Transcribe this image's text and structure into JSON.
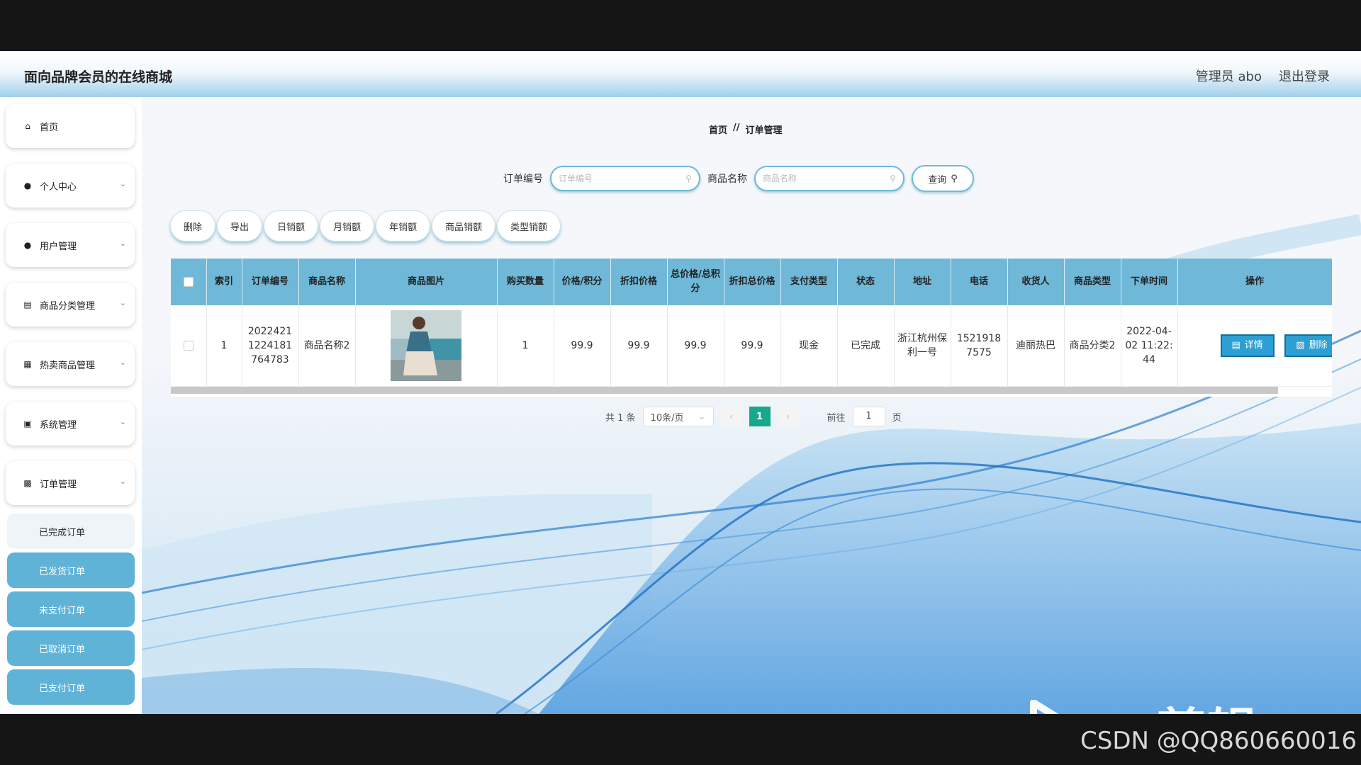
{
  "header": {
    "title": "面向品牌会员的在线商城",
    "user_label": "管理员 abo",
    "logout_label": "退出登录"
  },
  "sidebar": {
    "items": [
      {
        "label": "首页",
        "icon": "home-icon"
      },
      {
        "label": "个人中心",
        "icon": "user-icon"
      },
      {
        "label": "用户管理",
        "icon": "user-icon"
      },
      {
        "label": "商品分类管理",
        "icon": "category-icon"
      },
      {
        "label": "热卖商品管理",
        "icon": "grid-icon"
      },
      {
        "label": "系统管理",
        "icon": "clipboard-icon"
      },
      {
        "label": "订单管理",
        "icon": "order-icon"
      }
    ],
    "order_sub_items": [
      "已完成订单",
      "已发货订单",
      "未支付订单",
      "已取消订单",
      "已支付订单"
    ]
  },
  "breadcrumb": {
    "home": "首页",
    "separator": "//",
    "current": "订单管理"
  },
  "search": {
    "order_no_label": "订单编号",
    "order_no_placeholder": "订单编号",
    "product_name_label": "商品名称",
    "product_name_placeholder": "商品名称",
    "query_label": "查询"
  },
  "actions": [
    "删除",
    "导出",
    "日销额",
    "月销额",
    "年销额",
    "商品销额",
    "类型销额"
  ],
  "table": {
    "headers": [
      "索引",
      "订单编号",
      "商品名称",
      "商品图片",
      "购买数量",
      "价格/积分",
      "折扣价格",
      "总价格/总积分",
      "折扣总价格",
      "支付类型",
      "状态",
      "地址",
      "电话",
      "收货人",
      "商品类型",
      "下单时间",
      "操作"
    ],
    "rows": [
      {
        "index": "1",
        "order_no": "20224211224181764783",
        "product_name": "商品名称2",
        "quantity": "1",
        "price": "99.9",
        "discount_price": "99.9",
        "total_price": "99.9",
        "discount_total": "99.9",
        "pay_type": "现金",
        "status": "已完成",
        "address": "浙江杭州保利一号",
        "phone": "15219187575",
        "receiver": "迪丽热巴",
        "product_type": "商品分类2",
        "order_time": "2022-04-02 11:22:44",
        "detail_label": "详情",
        "delete_label": "删除"
      }
    ]
  },
  "pagination": {
    "total_text": "共 1 条",
    "page_size": "10条/页",
    "current_page": "1",
    "goto_label": "前往",
    "goto_value": "1",
    "page_suffix": "页"
  },
  "watermark": {
    "text": "ev剪辑",
    "csdn": "CSDN @QQ860660016"
  },
  "colors": {
    "accent": "#6fb8d8",
    "active_page": "#17a88b",
    "sub_menu": "#5fb3d6",
    "button": "#2c9fd4"
  }
}
